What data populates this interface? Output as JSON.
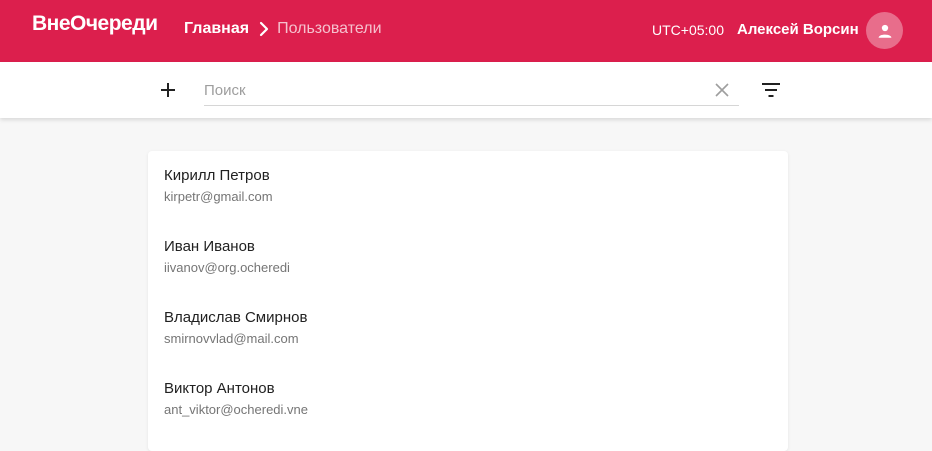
{
  "header": {
    "logo": "ВнеОчереди",
    "breadcrumb": {
      "home": "Главная",
      "current": "Пользователи"
    },
    "timezone": "UTC+05:00",
    "user_name": "Алексей Ворсин",
    "brand_color": "#dc1f4d"
  },
  "toolbar": {
    "add_icon": "plus-icon",
    "search": {
      "placeholder": "Поиск",
      "value": ""
    },
    "clear_icon": "close-icon",
    "filter_icon": "filter-icon"
  },
  "users": [
    {
      "name": "Кирилл Петров",
      "email": "kirpetr@gmail.com"
    },
    {
      "name": "Иван Иванов",
      "email": "iivanov@org.ocheredi"
    },
    {
      "name": "Владислав Смирнов",
      "email": "smirnovvlad@mail.com"
    },
    {
      "name": "Виктор Антонов",
      "email": "ant_viktor@ocheredi.vne"
    }
  ]
}
